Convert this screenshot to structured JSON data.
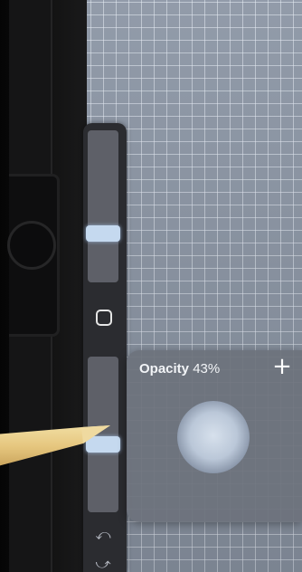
{
  "sidebar": {
    "size_slider": {
      "icon": "slider-size",
      "level_percent": 30
    },
    "modify_button": {
      "icon": "square-icon"
    },
    "opacity_slider": {
      "icon": "slider-opacity",
      "level_percent": 43
    },
    "undo": {
      "icon": "undo-icon",
      "glyph": "⤺"
    },
    "redo": {
      "icon": "redo-icon",
      "glyph": "⤻"
    }
  },
  "opacity_popover": {
    "label": "Opacity",
    "value": "43%",
    "plus_glyph": "+"
  },
  "colors": {
    "canvas": "#8c96a5",
    "sidebar": "#2b2c30",
    "thumb": "#c5d9ef"
  }
}
